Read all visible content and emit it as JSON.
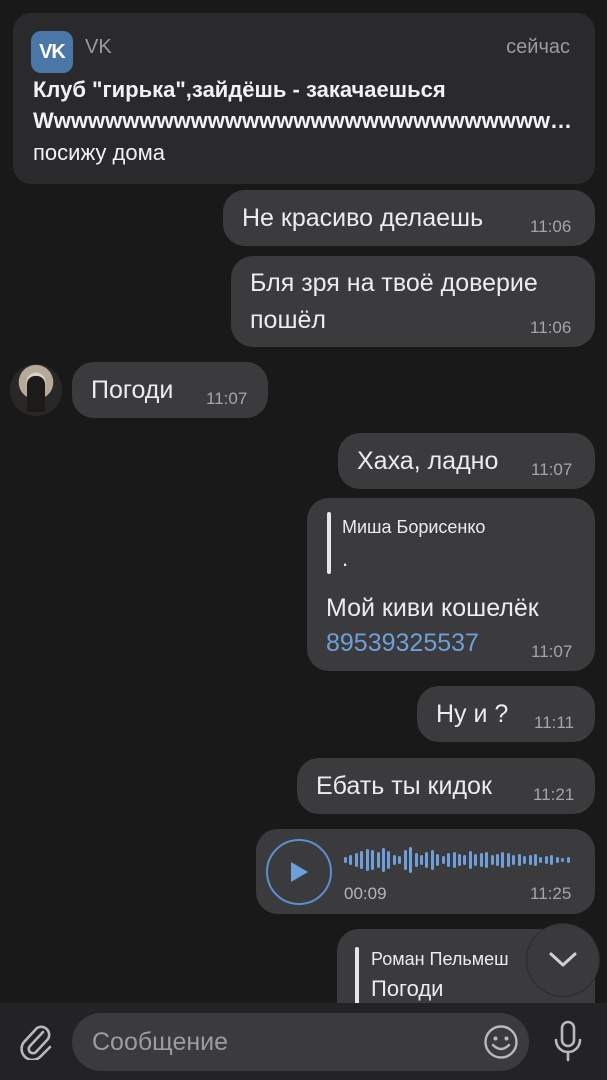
{
  "notification": {
    "app_icon_text": "VK",
    "app_name": "VK",
    "time": "сейчас",
    "title": "Клуб \"гирька\",зайдёшь - закачаешься",
    "subtitle": "Wwwwwwwwwwwwwwwwwwwwwwwwwwwwwwwwwwwwwwwwwww...",
    "body": "посижу дома"
  },
  "messages": [
    {
      "text": "Не красиво делаешь",
      "time": "11:06"
    },
    {
      "line1": "Бля зря на твоё доверие",
      "line2": "пошёл",
      "time": "11:06"
    },
    {
      "text": "Погоди",
      "time": "11:07"
    },
    {
      "text": "Хаха, ладно",
      "time": "11:07"
    },
    {
      "reply_name": "Миша Борисенко",
      "reply_text": ".",
      "line1": "Мой киви кошелёк",
      "link": "89539325537",
      "time": "11:07"
    },
    {
      "text": "Ну и ?",
      "time": "11:11"
    },
    {
      "text": "Ебать ты кидок",
      "time": "11:21"
    },
    {
      "duration": "00:09",
      "time": "11:25",
      "waveform": [
        6,
        10,
        14,
        18,
        22,
        20,
        16,
        24,
        18,
        10,
        8,
        20,
        26,
        14,
        10,
        16,
        20,
        12,
        8,
        14,
        16,
        12,
        10,
        18,
        12,
        14,
        16,
        10,
        12,
        16,
        14,
        10,
        12,
        8,
        10,
        12,
        6,
        8,
        10,
        6,
        4,
        6
      ]
    },
    {
      "reply_name": "Роман Пельмеш",
      "reply_text": "Погоди"
    }
  ],
  "input": {
    "placeholder": "Сообщение"
  },
  "colors": {
    "accent": "#6e9fd8",
    "bubble": "#3b3b3e",
    "background": "#19191a",
    "vk_brand": "#4a76a8"
  },
  "icons": [
    "vk-logo-icon",
    "play-icon",
    "chevron-down-icon",
    "paperclip-icon",
    "emoji-icon",
    "microphone-icon"
  ]
}
